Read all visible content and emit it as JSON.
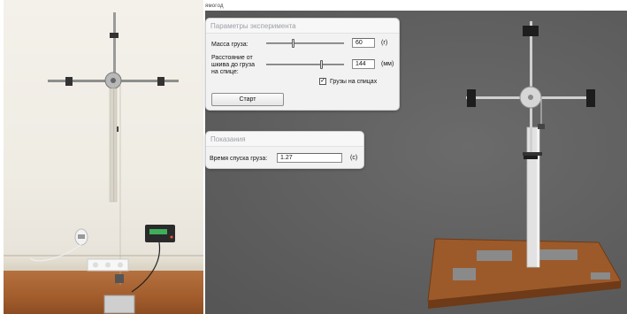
{
  "window": {
    "caption": "ямогод"
  },
  "parameters_panel": {
    "title": "Параметры эксперимента",
    "mass": {
      "label": "Масса груза:",
      "value": "60",
      "unit": "(г)",
      "slider_fraction": 0.34
    },
    "distance": {
      "label_line1": "Расстояние от",
      "label_line2": "шкива до груза",
      "label_line3": "на спице:",
      "value": "144",
      "unit": "(мм)",
      "slider_fraction": 0.72
    },
    "weights_checkbox": {
      "label": "Грузы на спицах",
      "checked": true,
      "mark": "✓"
    },
    "start_button": "Старт"
  },
  "readings_panel": {
    "title": "Показания",
    "descent_time": {
      "label": "Время спуска груза:",
      "value": "1.27",
      "unit": "(с)"
    }
  },
  "colors": {
    "scene_background": "#5f5f5f",
    "wood_base": "#9c5a2a",
    "wood_dark": "#6e3a17",
    "metal_pole": "#dcdcdc",
    "wall": "#f1eee6",
    "floor": "#a35d2d",
    "panel_bg": "#f2f2f2",
    "panel_title_text": "#9aa0a8"
  },
  "icons": {
    "checkbox": "check-mark",
    "timer_display": "digital-timer-icon"
  }
}
